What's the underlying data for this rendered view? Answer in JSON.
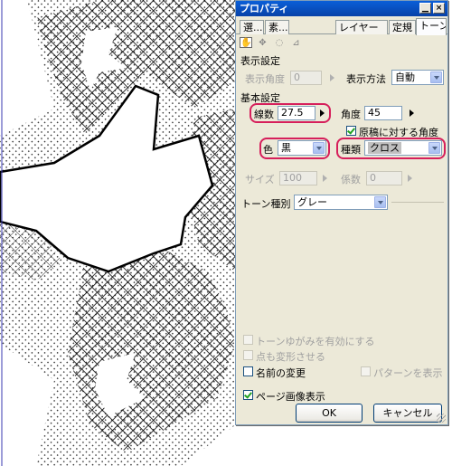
{
  "panel": {
    "title": "プロパティ",
    "window_buttons": {
      "minimize": "▁",
      "close": "×"
    },
    "tabs": [
      "選...",
      "素...",
      "レイヤー",
      "定規",
      "トーン"
    ],
    "active_tab": "トーン",
    "tool_icons": [
      "hand-icon",
      "move-icon",
      "rotate-icon",
      "transform-icon"
    ],
    "display_section": {
      "heading": "表示設定",
      "angle_label": "表示角度",
      "angle_value": "0",
      "method_label": "表示方法",
      "method_value": "自動"
    },
    "basic_section": {
      "heading": "基本設定",
      "lines_label": "線数",
      "lines_value": "27.5",
      "angle_label": "角度",
      "angle_value": "45",
      "relative_angle_label": "原稿に対する角度",
      "relative_angle_checked": true,
      "color_label": "色",
      "color_value": "黒",
      "type_label": "種類",
      "type_value": "クロス",
      "size_label": "サイズ",
      "size_value": "100",
      "factor_label": "係数",
      "factor_value": "0"
    },
    "tone_kind_label": "トーン種別",
    "tone_kind_value": "グレー",
    "options": {
      "distort_label": "トーンゆがみを有効にする",
      "distort_checked": false,
      "points_label": "点も変形させる",
      "points_checked": false,
      "rename_label": "名前の変更",
      "rename_checked": false,
      "show_pattern_label": "パターンを表示",
      "show_pattern_checked": false,
      "page_image_label": "ページ画像表示",
      "page_image_checked": true
    },
    "ok_label": "OK",
    "cancel_label": "キャンセル"
  },
  "colors": {
    "titlebar": "#0842a8",
    "highlight_ring": "#d61f5b",
    "check_green": "#21a121"
  }
}
